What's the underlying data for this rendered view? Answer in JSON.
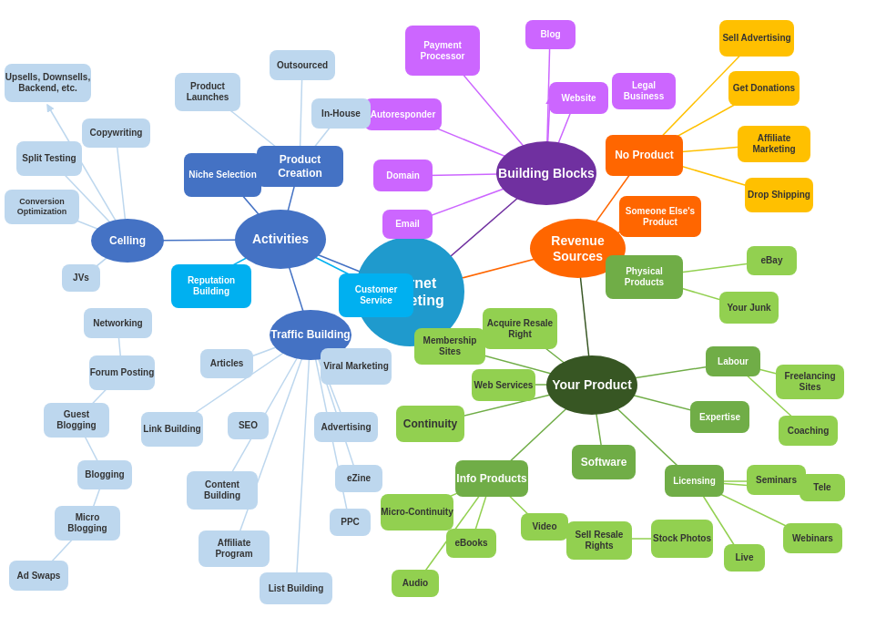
{
  "nodes": {
    "internet_marketing": {
      "label": "Internet Marketing"
    },
    "building_blocks": {
      "label": "Building Blocks"
    },
    "revenue_sources": {
      "label": "Revenue Sources"
    },
    "activities": {
      "label": "Activities"
    },
    "celling": {
      "label": "Celling"
    },
    "traffic_building": {
      "label": "Traffic Building"
    },
    "your_product": {
      "label": "Your Product"
    },
    "no_product": {
      "label": "No Product"
    },
    "someone_elses_product": {
      "label": "Someone Else's Product"
    },
    "physical_products": {
      "label": "Physical Products"
    },
    "product_creation": {
      "label": "Product Creation"
    },
    "niche_selection": {
      "label": "Niche Selection"
    },
    "reputation_building": {
      "label": "Reputation Building"
    },
    "customer_service": {
      "label": "Customer Service"
    },
    "payment_processor": {
      "label": "Payment Processor"
    },
    "blog": {
      "label": "Blog"
    },
    "website": {
      "label": "Website"
    },
    "legal_business": {
      "label": "Legal Business"
    },
    "autoresponder": {
      "label": "Autoresponder"
    },
    "domain": {
      "label": "Domain"
    },
    "email": {
      "label": "Email"
    },
    "sell_advertising": {
      "label": "Sell Advertising"
    },
    "get_donations": {
      "label": "Get Donations"
    },
    "affiliate_marketing": {
      "label": "Affiliate Marketing"
    },
    "drop_shipping": {
      "label": "Drop Shipping"
    },
    "ebay": {
      "label": "eBay"
    },
    "your_junk": {
      "label": "Your Junk"
    },
    "labour": {
      "label": "Labour"
    },
    "expertise": {
      "label": "Expertise"
    },
    "licensing": {
      "label": "Licensing"
    },
    "freelancing_sites": {
      "label": "Freelancing Sites"
    },
    "coaching": {
      "label": "Coaching"
    },
    "seminars": {
      "label": "Seminars"
    },
    "tele": {
      "label": "Tele"
    },
    "webinars": {
      "label": "Webinars"
    },
    "live": {
      "label": "Live"
    },
    "acquire_resale_right": {
      "label": "Acquire Resale Right"
    },
    "membership_sites": {
      "label": "Membership Sites"
    },
    "web_services": {
      "label": "Web Services"
    },
    "continuity": {
      "label": "Continuity"
    },
    "info_products": {
      "label": "Info Products"
    },
    "software": {
      "label": "Software"
    },
    "micro_continuity": {
      "label": "Micro-Continuity"
    },
    "ebooks": {
      "label": "eBooks"
    },
    "video": {
      "label": "Video"
    },
    "audio": {
      "label": "Audio"
    },
    "sell_resale_rights": {
      "label": "Sell Resale Rights"
    },
    "stock_photos": {
      "label": "Stock Photos"
    },
    "upsells": {
      "label": "Upsells, Downsells, Backend, etc."
    },
    "copywriting": {
      "label": "Copywriting"
    },
    "split_testing": {
      "label": "Split Testing"
    },
    "conversion_optimization": {
      "label": "Conversion Optimization"
    },
    "jvs": {
      "label": "JVs"
    },
    "networking": {
      "label": "Networking"
    },
    "forum_posting": {
      "label": "Forum Posting"
    },
    "guest_blogging": {
      "label": "Guest Blogging"
    },
    "blogging": {
      "label": "Blogging"
    },
    "micro_blogging": {
      "label": "Micro Blogging"
    },
    "ad_swaps": {
      "label": "Ad Swaps"
    },
    "articles": {
      "label": "Articles"
    },
    "link_building": {
      "label": "Link Building"
    },
    "seo": {
      "label": "SEO"
    },
    "content_building": {
      "label": "Content Building"
    },
    "affiliate_program": {
      "label": "Affiliate Program"
    },
    "viral_marketing": {
      "label": "Viral Marketing"
    },
    "advertising": {
      "label": "Advertising"
    },
    "ezine": {
      "label": "eZine"
    },
    "ppc": {
      "label": "PPC"
    },
    "list_building": {
      "label": "List Building"
    },
    "outsourced": {
      "label": "Outsourced"
    },
    "in_house": {
      "label": "In-House"
    },
    "product_launches": {
      "label": "Product Launches"
    }
  }
}
